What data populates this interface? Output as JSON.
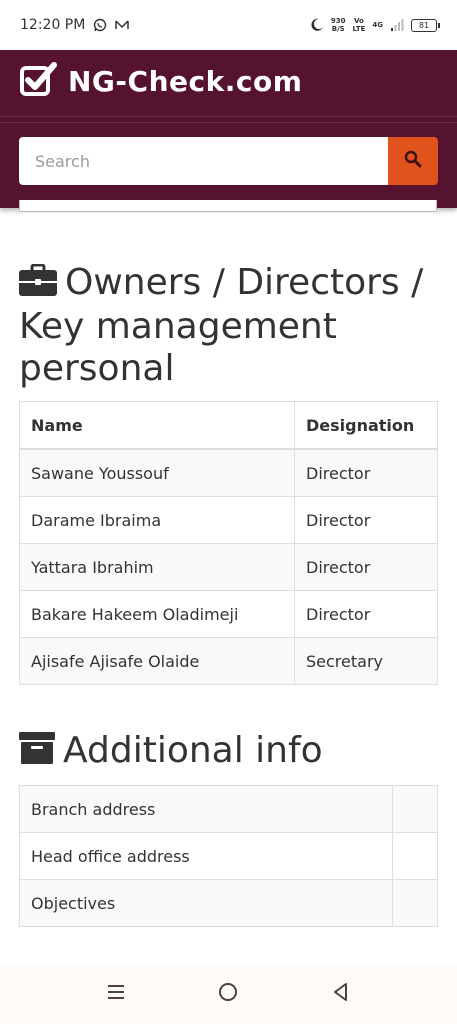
{
  "status_bar": {
    "time": "12:20 PM",
    "speed_top": "930",
    "speed_bottom": "B/S",
    "volte_top": "Vo",
    "volte_bottom": "LTE",
    "network": "4G",
    "battery": "81"
  },
  "header": {
    "brand": "NG-Check.com",
    "search_placeholder": "Search"
  },
  "owners_section": {
    "title": "Owners / Directors / Key management personal",
    "columns": [
      "Name",
      "Designation"
    ],
    "rows": [
      {
        "name": "Sawane Youssouf",
        "designation": "Director"
      },
      {
        "name": "Darame Ibraima",
        "designation": "Director"
      },
      {
        "name": "Yattara Ibrahim",
        "designation": "Director"
      },
      {
        "name": "Bakare Hakeem Oladimeji",
        "designation": "Director"
      },
      {
        "name": "Ajisafe Ajisafe Olaide",
        "designation": "Secretary"
      }
    ]
  },
  "additional_section": {
    "title": "Additional info",
    "rows": [
      {
        "label": "Branch address",
        "value": ""
      },
      {
        "label": "Head office address",
        "value": ""
      },
      {
        "label": "Objectives",
        "value": ""
      }
    ]
  },
  "colors": {
    "header_bg": "#561330",
    "search_button": "#e0531c"
  }
}
